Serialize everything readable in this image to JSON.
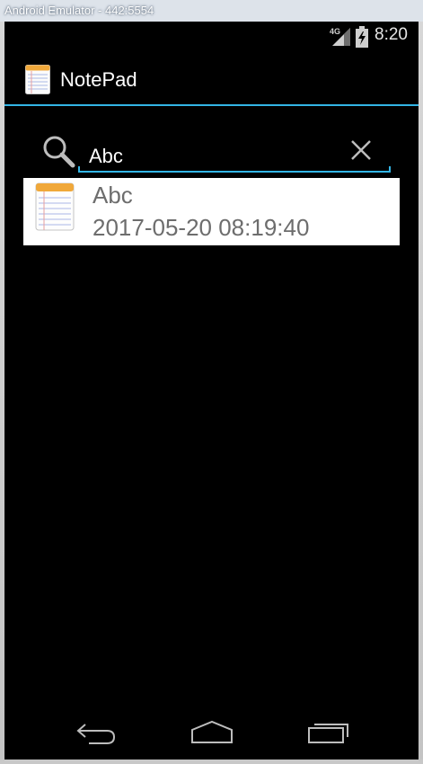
{
  "window": {
    "title": "Android Emulator - 442:5554"
  },
  "status_bar": {
    "network_type": "4G",
    "time": "8:20",
    "signal_icon": "cell-signal-icon",
    "battery_icon": "battery-icon"
  },
  "action_bar": {
    "app_icon": "notepad-icon",
    "title": "NotePad"
  },
  "search": {
    "value": "Abc",
    "search_icon": "magnifier-icon",
    "clear_icon": "close-icon"
  },
  "notes": [
    {
      "title": "Abc",
      "date": "2017-05-20 08:19:40",
      "icon": "notepad-icon"
    }
  ],
  "nav_bar": {
    "back_icon": "back-arrow-icon",
    "home_icon": "home-icon",
    "recents_icon": "recent-apps-icon"
  },
  "colors": {
    "accent": "#33b5e5",
    "screen_background": "#000000",
    "list_item_background": "#ffffff",
    "list_text": "#6d6d6d"
  }
}
